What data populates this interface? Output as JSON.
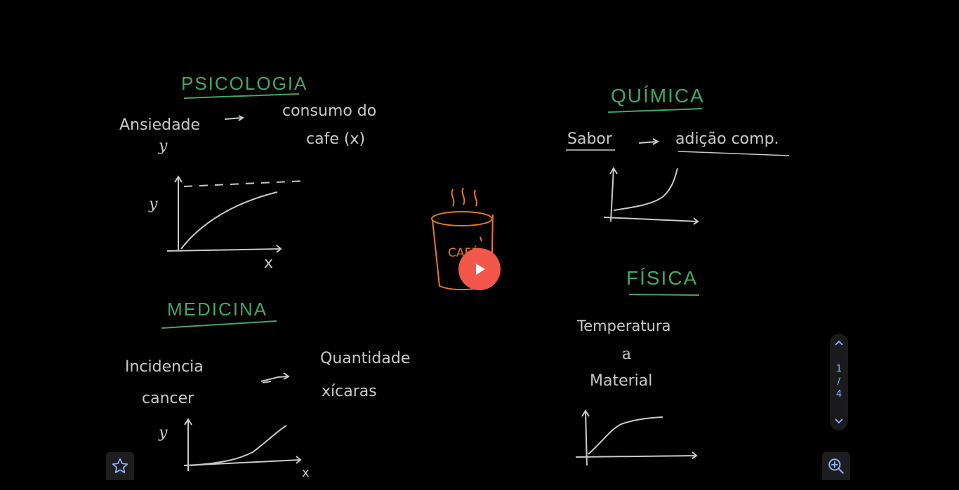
{
  "board": {
    "psicologia": {
      "title": "PSICOLOGIA",
      "left": "Ansiedade",
      "left_var": "y",
      "right_1": "consumo do",
      "right_2": "cafe (x)",
      "axis_y": "y",
      "axis_x": "x"
    },
    "medicina": {
      "title": "MEDICINA",
      "left_1": "Incidencia",
      "left_2": "cancer",
      "right_1": "Quantidade",
      "right_2": "xícaras",
      "axis_y": "y",
      "axis_x": "x"
    },
    "quimica": {
      "title": "QUÍMICA",
      "left": "Sabor",
      "right": "adição comp."
    },
    "fisica": {
      "title": "FÍSICA",
      "line_1": "Temperatura",
      "line_2": "a",
      "line_3": "Material"
    },
    "cup_label": "CAFÉ"
  },
  "pager": {
    "current": "1",
    "separator": "/",
    "total": "4"
  },
  "icons": {
    "play": "play-icon",
    "star": "star-icon",
    "zoom": "zoom-in-icon",
    "up": "chevron-up-icon",
    "down": "chevron-down-icon"
  },
  "colors": {
    "chalk_green": "#3fa86a",
    "chalk_white": "#c9c9c9",
    "chalk_orange": "#e07a2a",
    "accent_red": "#f2574a",
    "accent_blue": "#8fb4ff"
  }
}
